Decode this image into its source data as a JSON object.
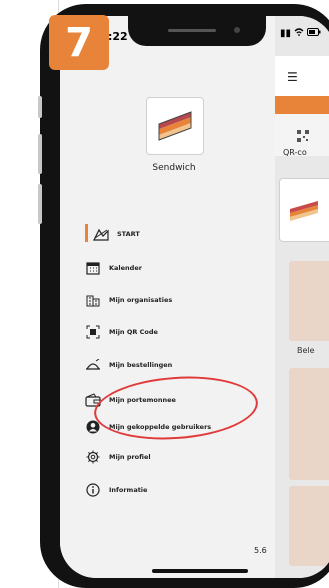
{
  "step_badge": "7",
  "status_bar": {
    "time": ":22",
    "signal": "▮▮",
    "wifi": "◔"
  },
  "drawer": {
    "brand_name": "Sendwich",
    "active_item": "START",
    "items": [
      {
        "label": "START",
        "icon": "building-icon"
      },
      {
        "label": "Kalender",
        "icon": "calendar-icon"
      },
      {
        "label": "Mijn organisaties",
        "icon": "organisation-icon"
      },
      {
        "label": "Mijn QR Code",
        "icon": "qr-code-icon"
      },
      {
        "label": "Mijn bestellingen",
        "icon": "order-icon"
      },
      {
        "label": "Mijn portemonnee",
        "icon": "wallet-icon"
      },
      {
        "label": "Mijn gekoppelde gebruikers",
        "icon": "user-icon"
      },
      {
        "label": "Mijn profiel",
        "icon": "gear-icon"
      },
      {
        "label": "Informatie",
        "icon": "info-icon"
      }
    ],
    "version": "5.6"
  },
  "background_app": {
    "menu_icon": "hamburger-icon",
    "qr_tile_label": "QR-co",
    "food_card_label": "Bele"
  },
  "colors": {
    "accent": "#e8833a",
    "annotation": "#e03a3a",
    "drawer_bg": "#f2f2f2"
  }
}
